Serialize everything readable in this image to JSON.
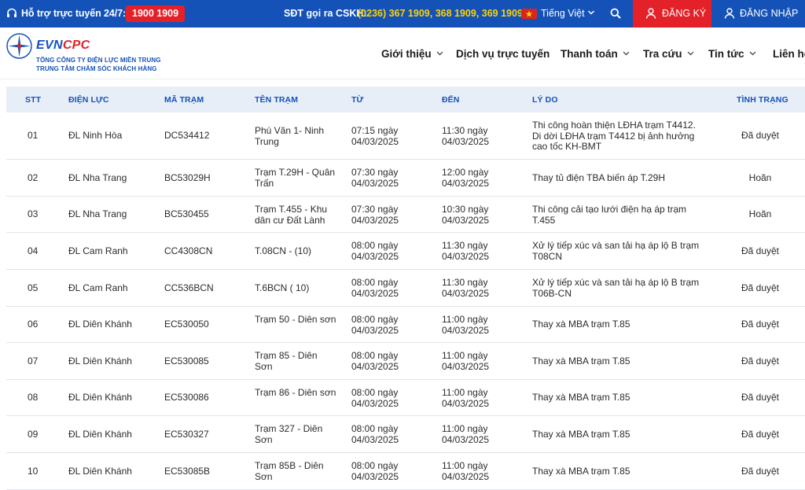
{
  "topbar": {
    "support_label": "Hỗ trợ trực tuyến 24/7:",
    "hotline": "1900 1909",
    "cskh_label": "SĐT gọi ra CSKH:",
    "cskh_phones": "(0236) 367 1909, 368 1909, 369 1909",
    "language": "Tiếng Việt",
    "register_label": "ĐĂNG KÝ",
    "login_label": "ĐĂNG NHẬP",
    "colors": {
      "bar": "#1452b8",
      "accent_red": "#e42128",
      "phone_yellow": "#ffd200"
    }
  },
  "header": {
    "logo_evn": "EVN",
    "logo_cpc": "CPC",
    "logo_line1": "TỔNG CÔNG TY ĐIỆN LỰC MIỀN TRUNG",
    "logo_line2": "TRUNG TÂM CHĂM SÓC KHÁCH HÀNG",
    "nav": [
      {
        "label": "Giới thiệu",
        "dropdown": true
      },
      {
        "label": "Dịch vụ trực tuyến",
        "dropdown": false
      },
      {
        "label": "Thanh toán",
        "dropdown": true
      },
      {
        "label": "Tra cứu",
        "dropdown": true
      },
      {
        "label": "Tin tức",
        "dropdown": true
      },
      {
        "label": "Liên hệ",
        "dropdown": false
      }
    ]
  },
  "table": {
    "columns": [
      "STT",
      "ĐIỆN LỰC",
      "MÃ TRẠM",
      "TÊN TRẠM",
      "TỪ",
      "ĐẾN",
      "LÝ DO",
      "TÌNH TRẠNG"
    ],
    "rows": [
      {
        "stt": "01",
        "dien_luc": "ĐL Ninh Hòa",
        "ma_tram": "DC534412",
        "ten_tram": "Phú Văn 1- Ninh Trung",
        "tu": "07:15 ngày 04/03/2025",
        "den": "11:30 ngày 04/03/2025",
        "ly_do": "Thi công hoàn thiện LĐHA trạm T4412. Di dời LĐHA trạm T4412 bị ảnh hưởng cao tốc KH-BMT",
        "tinh_trang": "Đã duyệt"
      },
      {
        "stt": "02",
        "dien_luc": "ĐL Nha Trang",
        "ma_tram": "BC53029H",
        "ten_tram": "Trạm T.29H - Quân Trấn",
        "tu": "07:30 ngày 04/03/2025",
        "den": "12:00 ngày 04/03/2025",
        "ly_do": "Thay tủ điện TBA biến áp T.29H",
        "tinh_trang": "Hoãn"
      },
      {
        "stt": "03",
        "dien_luc": "ĐL Nha Trang",
        "ma_tram": "BC530455",
        "ten_tram": "Trạm T.455 - Khu dân cư Đất Lành",
        "tu": "07:30 ngày 04/03/2025",
        "den": "10:30 ngày 04/03/2025",
        "ly_do": "Thi công cải tạo lưới điện hạ áp trạm T.455",
        "tinh_trang": "Hoãn"
      },
      {
        "stt": "04",
        "dien_luc": "ĐL Cam Ranh",
        "ma_tram": "CC4308CN",
        "ten_tram": "T.08CN - (10)",
        "tu": "08:00 ngày 04/03/2025",
        "den": "11:30 ngày 04/03/2025",
        "ly_do": "Xử lý tiếp xúc và san tải hạ áp lộ B trạm T08CN",
        "tinh_trang": "Đã duyệt"
      },
      {
        "stt": "05",
        "dien_luc": "ĐL Cam Ranh",
        "ma_tram": "CC536BCN",
        "ten_tram": "T.6BCN ( 10)",
        "tu": "08:00 ngày 04/03/2025",
        "den": "11:30 ngày 04/03/2025",
        "ly_do": "Xử lý tiếp xúc và san tải hạ áp lộ B trạm T06B-CN",
        "tinh_trang": "Đã duyệt"
      },
      {
        "stt": "06",
        "dien_luc": "ĐL Diên Khánh",
        "ma_tram": "EC530050",
        "ten_tram": "Trạm 50 - Diên sơn",
        "tu": "08:00 ngày 04/03/2025",
        "den": "11:00 ngày 04/03/2025",
        "ly_do": "Thay xà MBA trạm T.85",
        "tinh_trang": "Đã duyệt"
      },
      {
        "stt": "07",
        "dien_luc": "ĐL Diên Khánh",
        "ma_tram": "EC530085",
        "ten_tram": "Trạm 85 - Diên Sơn",
        "tu": "08:00 ngày 04/03/2025",
        "den": "11:00 ngày 04/03/2025",
        "ly_do": "Thay xà MBA trạm T.85",
        "tinh_trang": "Đã duyệt"
      },
      {
        "stt": "08",
        "dien_luc": "ĐL Diên Khánh",
        "ma_tram": "EC530086",
        "ten_tram": "Trạm 86 - Diên sơn",
        "tu": "08:00 ngày 04/03/2025",
        "den": "11:00 ngày 04/03/2025",
        "ly_do": "Thay xà MBA trạm T.85",
        "tinh_trang": "Đã duyệt"
      },
      {
        "stt": "09",
        "dien_luc": "ĐL Diên Khánh",
        "ma_tram": "EC530327",
        "ten_tram": "Trạm 327 - Diên Sơn",
        "tu": "08:00 ngày 04/03/2025",
        "den": "11:00 ngày 04/03/2025",
        "ly_do": "Thay xà MBA trạm T.85",
        "tinh_trang": "Đã duyệt"
      },
      {
        "stt": "10",
        "dien_luc": "ĐL Diên Khánh",
        "ma_tram": "EC53085B",
        "ten_tram": "Trạm 85B - Diên Sơn",
        "tu": "08:00 ngày 04/03/2025",
        "den": "11:00 ngày 04/03/2025",
        "ly_do": "Thay xà MBA trạm T.85",
        "tinh_trang": "Đã duyệt"
      }
    ]
  }
}
